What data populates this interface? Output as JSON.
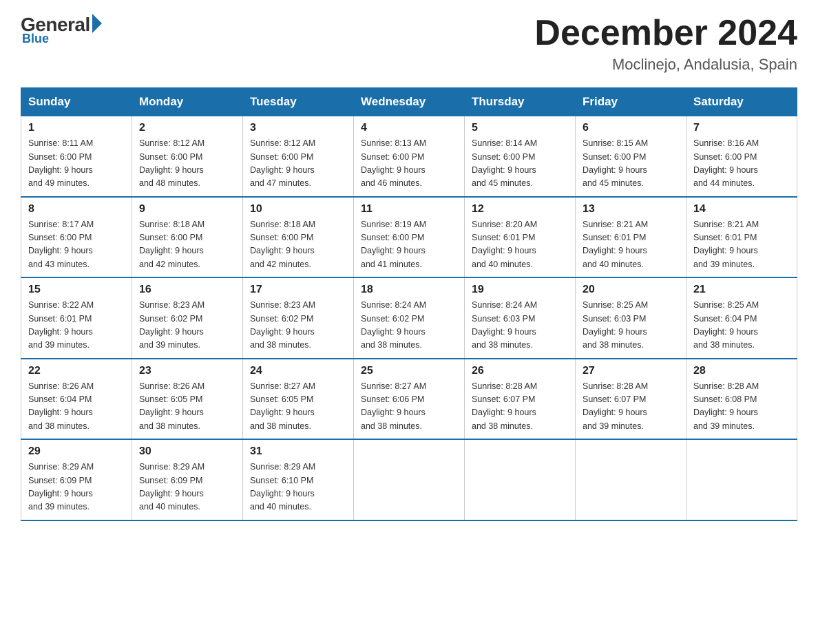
{
  "header": {
    "logo_general": "General",
    "logo_blue": "Blue",
    "month_title": "December 2024",
    "location": "Moclinejo, Andalusia, Spain"
  },
  "days_of_week": [
    "Sunday",
    "Monday",
    "Tuesday",
    "Wednesday",
    "Thursday",
    "Friday",
    "Saturday"
  ],
  "weeks": [
    [
      {
        "day": "1",
        "sunrise": "8:11 AM",
        "sunset": "6:00 PM",
        "daylight": "9 hours and 49 minutes."
      },
      {
        "day": "2",
        "sunrise": "8:12 AM",
        "sunset": "6:00 PM",
        "daylight": "9 hours and 48 minutes."
      },
      {
        "day": "3",
        "sunrise": "8:12 AM",
        "sunset": "6:00 PM",
        "daylight": "9 hours and 47 minutes."
      },
      {
        "day": "4",
        "sunrise": "8:13 AM",
        "sunset": "6:00 PM",
        "daylight": "9 hours and 46 minutes."
      },
      {
        "day": "5",
        "sunrise": "8:14 AM",
        "sunset": "6:00 PM",
        "daylight": "9 hours and 45 minutes."
      },
      {
        "day": "6",
        "sunrise": "8:15 AM",
        "sunset": "6:00 PM",
        "daylight": "9 hours and 45 minutes."
      },
      {
        "day": "7",
        "sunrise": "8:16 AM",
        "sunset": "6:00 PM",
        "daylight": "9 hours and 44 minutes."
      }
    ],
    [
      {
        "day": "8",
        "sunrise": "8:17 AM",
        "sunset": "6:00 PM",
        "daylight": "9 hours and 43 minutes."
      },
      {
        "day": "9",
        "sunrise": "8:18 AM",
        "sunset": "6:00 PM",
        "daylight": "9 hours and 42 minutes."
      },
      {
        "day": "10",
        "sunrise": "8:18 AM",
        "sunset": "6:00 PM",
        "daylight": "9 hours and 42 minutes."
      },
      {
        "day": "11",
        "sunrise": "8:19 AM",
        "sunset": "6:00 PM",
        "daylight": "9 hours and 41 minutes."
      },
      {
        "day": "12",
        "sunrise": "8:20 AM",
        "sunset": "6:01 PM",
        "daylight": "9 hours and 40 minutes."
      },
      {
        "day": "13",
        "sunrise": "8:21 AM",
        "sunset": "6:01 PM",
        "daylight": "9 hours and 40 minutes."
      },
      {
        "day": "14",
        "sunrise": "8:21 AM",
        "sunset": "6:01 PM",
        "daylight": "9 hours and 39 minutes."
      }
    ],
    [
      {
        "day": "15",
        "sunrise": "8:22 AM",
        "sunset": "6:01 PM",
        "daylight": "9 hours and 39 minutes."
      },
      {
        "day": "16",
        "sunrise": "8:23 AM",
        "sunset": "6:02 PM",
        "daylight": "9 hours and 39 minutes."
      },
      {
        "day": "17",
        "sunrise": "8:23 AM",
        "sunset": "6:02 PM",
        "daylight": "9 hours and 38 minutes."
      },
      {
        "day": "18",
        "sunrise": "8:24 AM",
        "sunset": "6:02 PM",
        "daylight": "9 hours and 38 minutes."
      },
      {
        "day": "19",
        "sunrise": "8:24 AM",
        "sunset": "6:03 PM",
        "daylight": "9 hours and 38 minutes."
      },
      {
        "day": "20",
        "sunrise": "8:25 AM",
        "sunset": "6:03 PM",
        "daylight": "9 hours and 38 minutes."
      },
      {
        "day": "21",
        "sunrise": "8:25 AM",
        "sunset": "6:04 PM",
        "daylight": "9 hours and 38 minutes."
      }
    ],
    [
      {
        "day": "22",
        "sunrise": "8:26 AM",
        "sunset": "6:04 PM",
        "daylight": "9 hours and 38 minutes."
      },
      {
        "day": "23",
        "sunrise": "8:26 AM",
        "sunset": "6:05 PM",
        "daylight": "9 hours and 38 minutes."
      },
      {
        "day": "24",
        "sunrise": "8:27 AM",
        "sunset": "6:05 PM",
        "daylight": "9 hours and 38 minutes."
      },
      {
        "day": "25",
        "sunrise": "8:27 AM",
        "sunset": "6:06 PM",
        "daylight": "9 hours and 38 minutes."
      },
      {
        "day": "26",
        "sunrise": "8:28 AM",
        "sunset": "6:07 PM",
        "daylight": "9 hours and 38 minutes."
      },
      {
        "day": "27",
        "sunrise": "8:28 AM",
        "sunset": "6:07 PM",
        "daylight": "9 hours and 39 minutes."
      },
      {
        "day": "28",
        "sunrise": "8:28 AM",
        "sunset": "6:08 PM",
        "daylight": "9 hours and 39 minutes."
      }
    ],
    [
      {
        "day": "29",
        "sunrise": "8:29 AM",
        "sunset": "6:09 PM",
        "daylight": "9 hours and 39 minutes."
      },
      {
        "day": "30",
        "sunrise": "8:29 AM",
        "sunset": "6:09 PM",
        "daylight": "9 hours and 40 minutes."
      },
      {
        "day": "31",
        "sunrise": "8:29 AM",
        "sunset": "6:10 PM",
        "daylight": "9 hours and 40 minutes."
      },
      null,
      null,
      null,
      null
    ]
  ],
  "labels": {
    "sunrise": "Sunrise:",
    "sunset": "Sunset:",
    "daylight": "Daylight:"
  }
}
